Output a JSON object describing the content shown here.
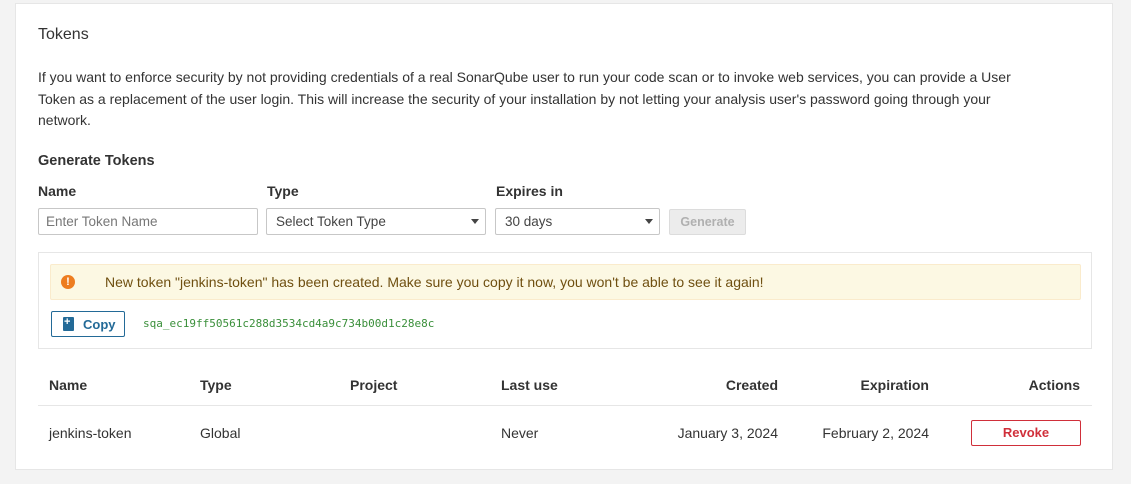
{
  "section": {
    "title": "Tokens",
    "description": "If you want to enforce security by not providing credentials of a real SonarQube user to run your code scan or to invoke web services, you can provide a User Token as a replacement of the user login. This will increase the security of your installation by not letting your analysis user's password going through your network."
  },
  "generate": {
    "heading": "Generate Tokens",
    "name_label": "Name",
    "name_placeholder": "Enter Token Name",
    "type_label": "Type",
    "type_value": "Select Token Type",
    "expires_label": "Expires in",
    "expires_value": "30 days",
    "generate_label": "Generate"
  },
  "new_token": {
    "message": "New token \"jenkins-token\" has been created. Make sure you copy it now, you won't be able to see it again!",
    "copy_label": "Copy",
    "value": "sqa_ec19ff50561c288d3534cd4a9c734b00d1c28e8c",
    "icons": {
      "alert": "warning-icon",
      "copy": "clipboard-icon"
    },
    "colors": {
      "alert_bg": "#fcf8e3",
      "token_text": "#3a8f3a",
      "copy_accent": "#236a97"
    }
  },
  "table": {
    "headers": {
      "name": "Name",
      "type": "Type",
      "project": "Project",
      "last_use": "Last use",
      "created": "Created",
      "expiration": "Expiration",
      "actions": "Actions"
    },
    "rows": [
      {
        "name": "jenkins-token",
        "type": "Global",
        "project": "",
        "last_use": "Never",
        "created": "January 3, 2024",
        "expiration": "February 2, 2024",
        "action_label": "Revoke"
      }
    ],
    "colors": {
      "revoke": "#d02f3a"
    }
  }
}
